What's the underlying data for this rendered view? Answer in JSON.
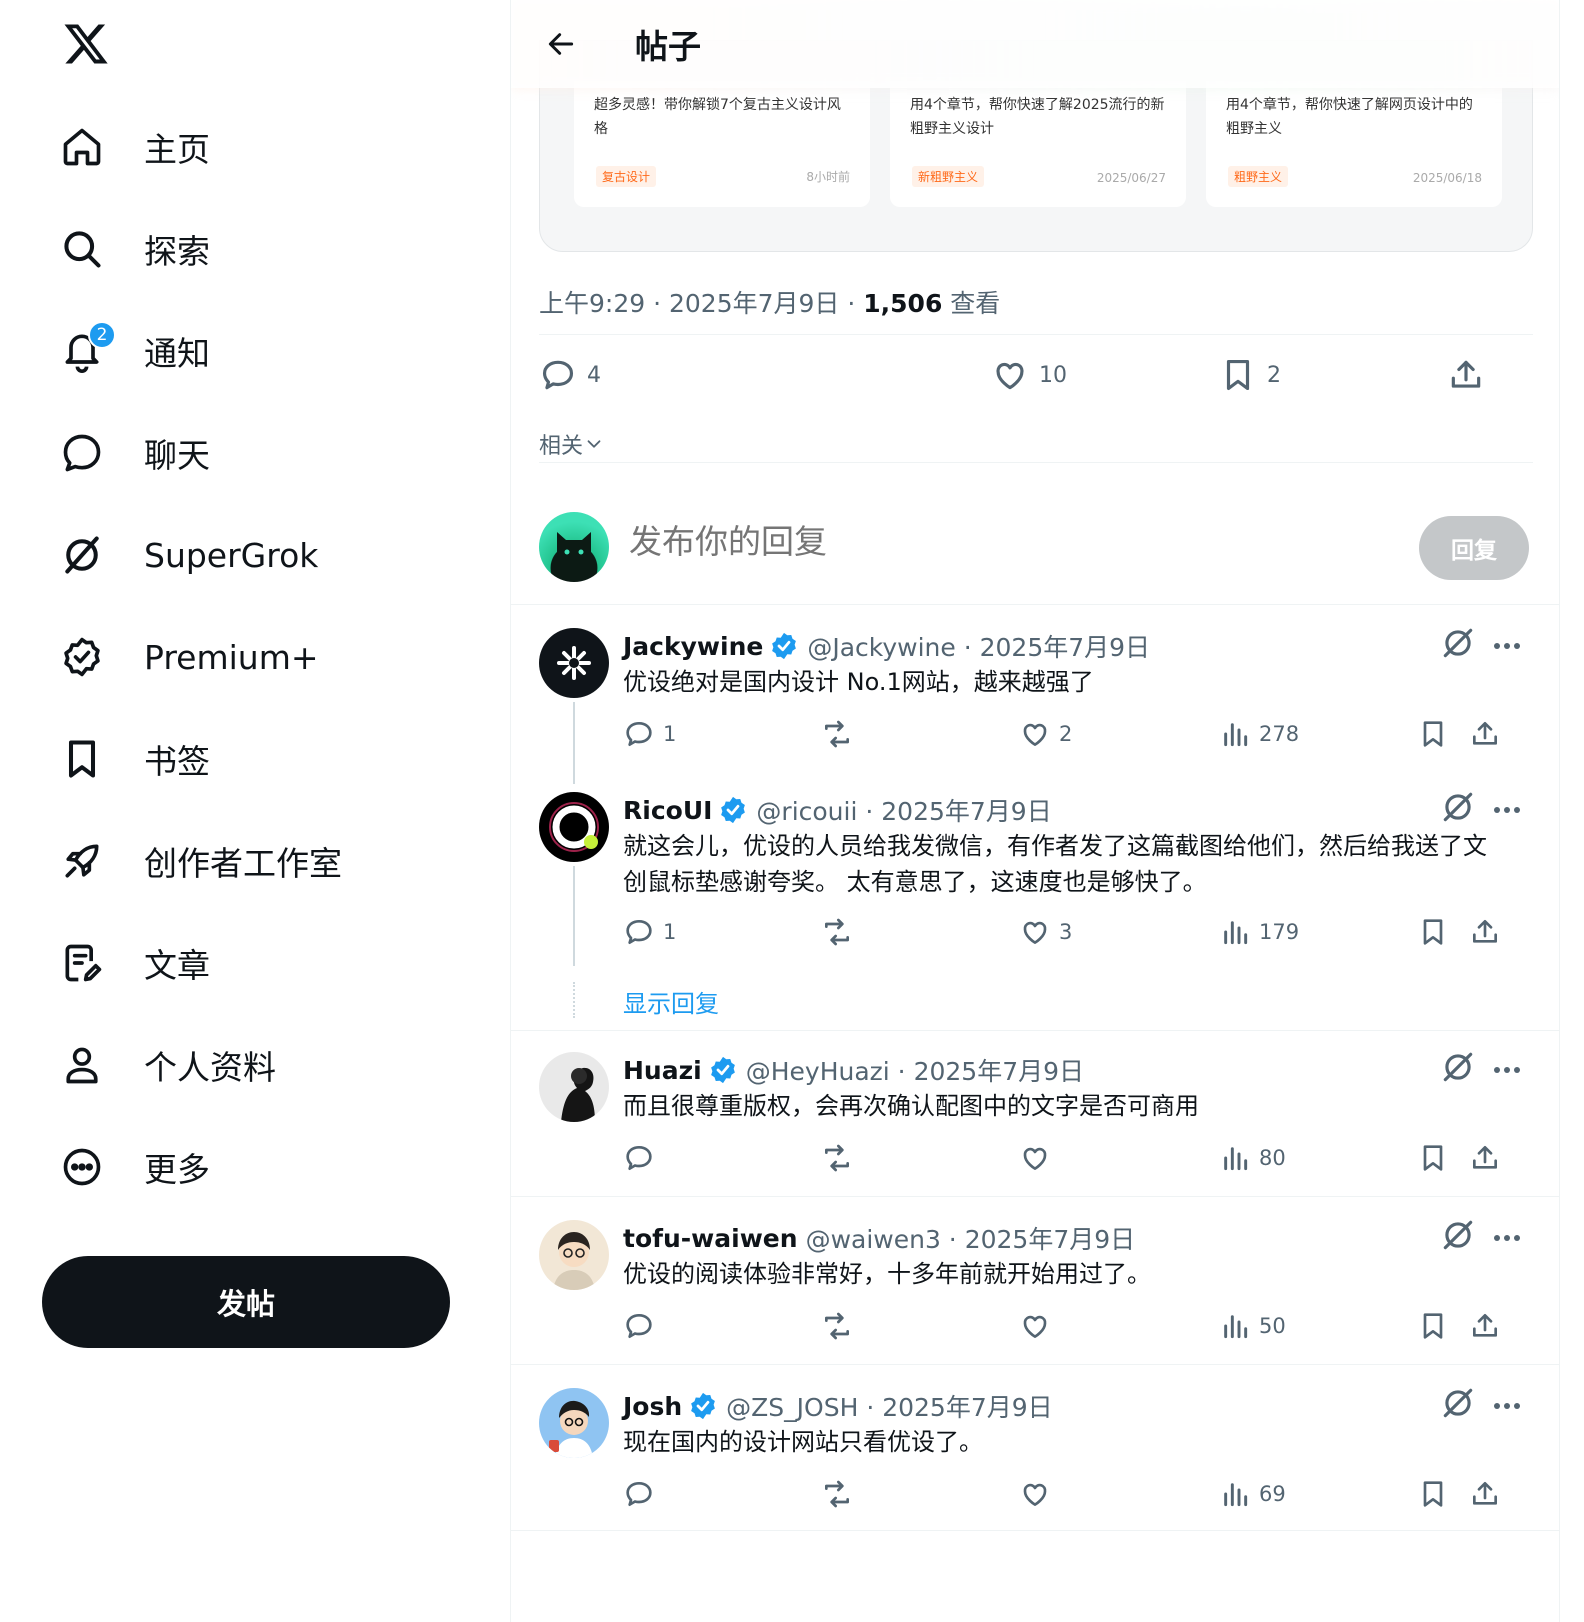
{
  "sidebar": {
    "logo_icon": "x-logo-icon",
    "items": [
      {
        "label": "主页",
        "icon": "home-icon"
      },
      {
        "label": "探索",
        "icon": "search-icon"
      },
      {
        "label": "通知",
        "icon": "bell-icon",
        "badge": "2"
      },
      {
        "label": "聊天",
        "icon": "chat-icon"
      },
      {
        "label": "SuperGrok",
        "icon": "grok-icon"
      },
      {
        "label": "Premium+",
        "icon": "verified-badge-icon"
      },
      {
        "label": "书签",
        "icon": "bookmark-icon"
      },
      {
        "label": "创作者工作室",
        "icon": "rocket-icon"
      },
      {
        "label": "文章",
        "icon": "article-icon"
      },
      {
        "label": "个人资料",
        "icon": "person-icon"
      },
      {
        "label": "更多",
        "icon": "more-circle-icon"
      }
    ],
    "post_button": "发帖"
  },
  "header": {
    "title": "帖子"
  },
  "cards": [
    {
      "title": "超多灵感！带你解锁7个复古主义设计风格",
      "tag": "复古设计",
      "date": "8小时前"
    },
    {
      "title": "用4个章节，帮你快速了解2025流行的新粗野主义设计",
      "tag": "新粗野主义",
      "date": "2025/06/27"
    },
    {
      "title": "用4个章节，帮你快速了解网页设计中的粗野主义",
      "tag": "粗野主义",
      "date": "2025/06/18"
    }
  ],
  "post_meta": {
    "time": "上午9:29 · 2025年7月9日 · ",
    "views": "1,506",
    "views_label": " 查看"
  },
  "post_stats": {
    "replies": "4",
    "likes": "10",
    "bookmarks": "2"
  },
  "related_label": "相关",
  "compose": {
    "placeholder": "发布你的回复",
    "button": "回复"
  },
  "show_replies": "显示回复",
  "colors": {
    "accent": "#1d9bf0",
    "text": "#0f1419",
    "muted": "#536471",
    "tag": "#ff6a1a"
  },
  "replies": [
    {
      "name": "Jackywine",
      "handle": "@Jackywine · 2025年7月9日",
      "text": "优设绝对是国内设计 No.1网站，越来越强了",
      "replies": "1",
      "likes": "2",
      "views": "278"
    },
    {
      "name": "RicoUI",
      "handle": "@ricouii · 2025年7月9日",
      "text": "就这会儿，优设的人员给我发微信，有作者发了这篇截图给他们，然后给我送了文创鼠标垫感谢夸奖。 太有意思了，这速度也是够快了。",
      "replies": "1",
      "likes": "3",
      "views": "179"
    },
    {
      "name": "Huazi",
      "handle": "@HeyHuazi · 2025年7月9日",
      "text": "而且很尊重版权，会再次确认配图中的文字是否可商用",
      "replies": "",
      "likes": "",
      "views": "80"
    },
    {
      "name": "tofu-waiwen",
      "handle": "@waiwen3 · 2025年7月9日",
      "text": "优设的阅读体验非常好，十多年前就开始用过了。",
      "replies": "",
      "likes": "",
      "views": "50"
    },
    {
      "name": "Josh",
      "handle": "@ZS_JOSH · 2025年7月9日",
      "text": "现在国内的设计网站只看优设了。",
      "replies": "",
      "likes": "",
      "views": "69"
    }
  ]
}
